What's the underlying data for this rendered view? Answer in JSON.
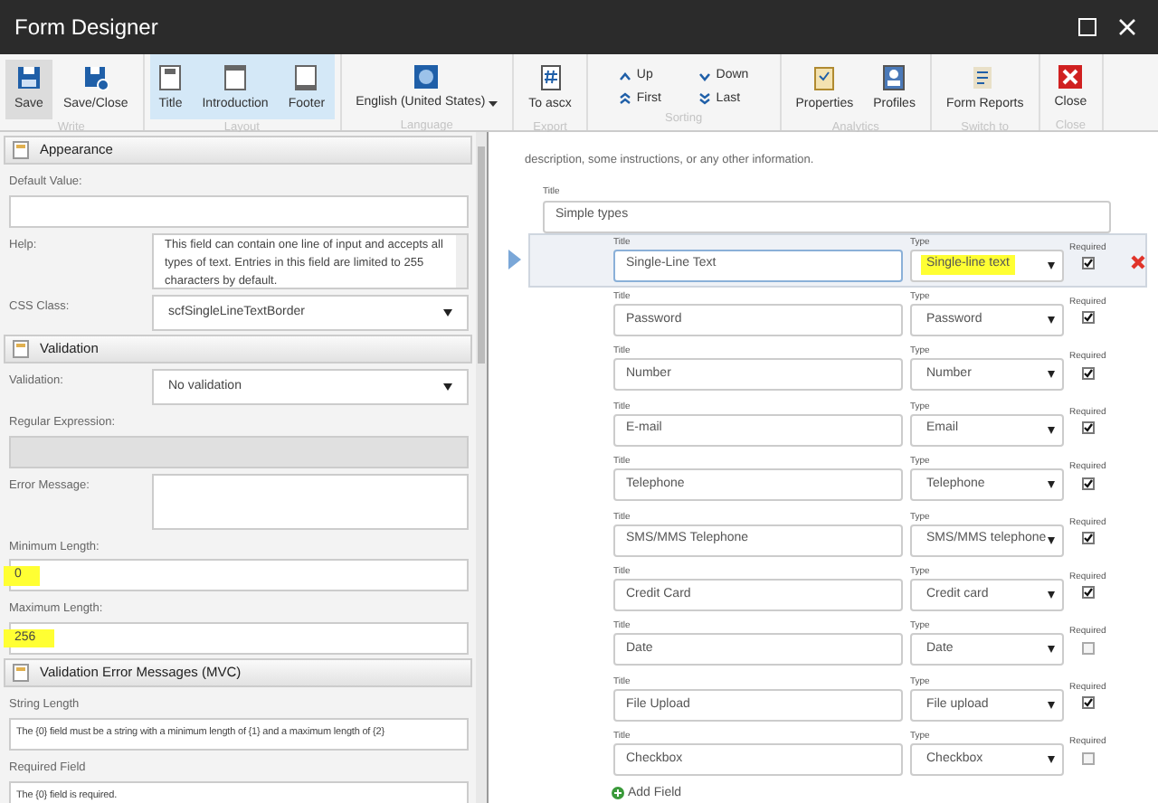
{
  "window": {
    "title": "Form Designer"
  },
  "ribbon": {
    "groups": [
      {
        "label": "Write",
        "buttons": [
          {
            "kind": "save",
            "label": "Save",
            "selected": true
          },
          {
            "kind": "saveclose",
            "label": "Save/Close",
            "selected": false
          }
        ]
      },
      {
        "label": "Layout",
        "buttons": [
          {
            "kind": "title",
            "label": "Title",
            "selected": true
          },
          {
            "kind": "intro",
            "label": "Introduction",
            "selected": true
          },
          {
            "kind": "footer",
            "label": "Footer",
            "selected": true
          }
        ]
      },
      {
        "label": "Language",
        "buttons": [
          {
            "kind": "globe",
            "label": "English (United States)",
            "selected": false
          }
        ]
      },
      {
        "label": "Export",
        "buttons": [
          {
            "kind": "ascx",
            "label": "To ascx",
            "selected": false
          }
        ]
      },
      {
        "label": "Sorting",
        "buttons": [
          {
            "kind": "up",
            "label": "Up",
            "selected": false
          },
          {
            "kind": "down",
            "label": "Down",
            "selected": false
          },
          {
            "kind": "first",
            "label": "First",
            "selected": false
          },
          {
            "kind": "last",
            "label": "Last",
            "selected": false
          }
        ]
      },
      {
        "label": "Analytics",
        "buttons": [
          {
            "kind": "props",
            "label": "Properties",
            "selected": false
          },
          {
            "kind": "profiles",
            "label": "Profiles",
            "selected": false
          }
        ]
      },
      {
        "label": "Switch to",
        "buttons": [
          {
            "kind": "reports",
            "label": "Form Reports",
            "selected": false
          }
        ]
      },
      {
        "label": "Close",
        "buttons": [
          {
            "kind": "close",
            "label": "Close",
            "selected": false
          }
        ]
      }
    ]
  },
  "properties": {
    "sections": [
      {
        "title": "Appearance",
        "items": [
          {
            "kind": "text",
            "label": "Default Value:",
            "value": ""
          },
          {
            "kind": "memo",
            "label": "Help:",
            "value": "This field can contain one line of input and accepts all types of text. Entries in this field are limited to 255 characters by default."
          },
          {
            "kind": "select",
            "label": "CSS Class:",
            "value": "scfSingleLineTextBorder"
          }
        ]
      },
      {
        "title": "Validation",
        "items": [
          {
            "kind": "select",
            "label": "Validation:",
            "value": "No validation"
          },
          {
            "kind": "disabled",
            "label": "Regular Expression:",
            "value": ""
          },
          {
            "kind": "area",
            "label": "Error Message:",
            "value": ""
          },
          {
            "kind": "text",
            "label": "Minimum Length:",
            "value": "0",
            "highlighted": true
          },
          {
            "kind": "text",
            "label": "Maximum Length:",
            "value": "256",
            "highlighted": true
          }
        ]
      },
      {
        "title": "Validation Error Messages (MVC)",
        "items": [
          {
            "kind": "text",
            "label": "String Length",
            "value": "The {0} field must be a string with a minimum length of {1} and a maximum length of {2}"
          },
          {
            "kind": "text",
            "label": "Required Field",
            "value": "The {0} field is required."
          }
        ]
      }
    ]
  },
  "form": {
    "intro_text": "description, some instructions, or any other information.",
    "section": {
      "title_label": "Title",
      "title": "Simple types"
    },
    "rows": [
      {
        "title_label": "Title",
        "title": "Single-Line Text",
        "type_label": "Type",
        "type": "Single-line text",
        "required_label": "Required",
        "required": true,
        "selected": true,
        "highlighted": true
      },
      {
        "title_label": "Title",
        "title": "Password",
        "type_label": "Type",
        "type": "Password",
        "required_label": "Required",
        "required": true,
        "selected": false,
        "highlighted": false
      },
      {
        "title_label": "Title",
        "title": "Number",
        "type_label": "Type",
        "type": "Number",
        "required_label": "Required",
        "required": true,
        "selected": false,
        "highlighted": false
      },
      {
        "title_label": "Title",
        "title": "E-mail",
        "type_label": "Type",
        "type": "Email",
        "required_label": "Required",
        "required": true,
        "selected": false,
        "highlighted": false
      },
      {
        "title_label": "Title",
        "title": "Telephone",
        "type_label": "Type",
        "type": "Telephone",
        "required_label": "Required",
        "required": true,
        "selected": false,
        "highlighted": false
      },
      {
        "title_label": "Title",
        "title": "SMS/MMS Telephone",
        "type_label": "Type",
        "type": "SMS/MMS telephone",
        "required_label": "Required",
        "required": true,
        "selected": false,
        "highlighted": false
      },
      {
        "title_label": "Title",
        "title": "Credit Card",
        "type_label": "Type",
        "type": "Credit card",
        "required_label": "Required",
        "required": true,
        "selected": false,
        "highlighted": false
      },
      {
        "title_label": "Title",
        "title": "Date",
        "type_label": "Type",
        "type": "Date",
        "required_label": "Required",
        "required": false,
        "selected": false,
        "highlighted": false
      },
      {
        "title_label": "Title",
        "title": "File Upload",
        "type_label": "Type",
        "type": "File upload",
        "required_label": "Required",
        "required": true,
        "selected": false,
        "highlighted": false
      },
      {
        "title_label": "Title",
        "title": "Checkbox",
        "type_label": "Type",
        "type": "Checkbox",
        "required_label": "Required",
        "required": false,
        "selected": false,
        "highlighted": false
      }
    ],
    "add_field": "Add Field"
  }
}
